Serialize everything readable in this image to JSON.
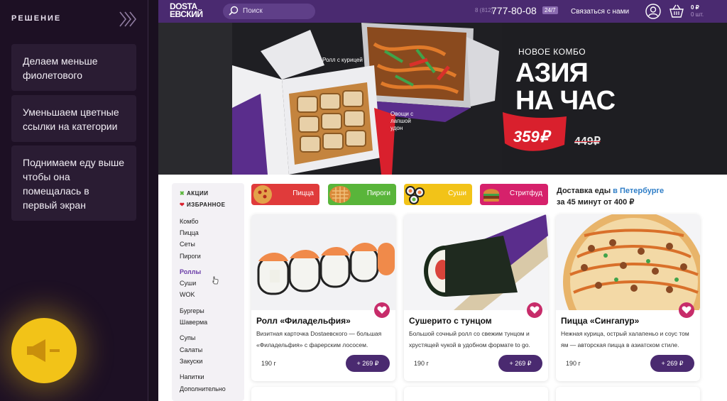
{
  "left_panel": {
    "title": "РЕШЕНИЕ",
    "cards": [
      "Делаем меньше фиолетового",
      "Уменьшаем цветные ссылки на категории",
      "Поднимаем еду выше чтобы она помещалась в первый экран"
    ]
  },
  "header": {
    "logo_line1": "DOSTA",
    "logo_line2": "ЕВСКИЙ",
    "search_placeholder": "Поиск",
    "phone_code": "8 (812)",
    "phone_number": "777-80-08",
    "hours_badge": "24/7",
    "contact_link": "Связаться с нами",
    "cart_sum": "0 ₽",
    "cart_count": "0 шт."
  },
  "banner": {
    "label_roll": "Ролл с курицей",
    "label_veg": "Овощи с лапшой удон",
    "subtitle": "НОВОЕ КОМБО",
    "headline_1": "АЗИЯ",
    "headline_2": "НА ЧАС",
    "price_new": "359₽",
    "price_old": "449₽"
  },
  "sidebar": {
    "promo": [
      {
        "label": "АКЦИИ",
        "icon": "percent-icon"
      },
      {
        "label": "ИЗБРАННОЕ",
        "icon": "heart-icon"
      }
    ],
    "groups": [
      [
        "Комбо",
        "Пицца",
        "Сеты",
        "Пироги"
      ],
      [
        "Роллы",
        "Суши",
        "WOK"
      ],
      [
        "Бургеры",
        "Шаверма"
      ],
      [
        "Супы",
        "Салаты",
        "Закуски"
      ],
      [
        "Напитки",
        "Дополнительно"
      ]
    ],
    "active": "Роллы"
  },
  "categories": [
    {
      "label": "Пицца",
      "color": "#e03b3b"
    },
    {
      "label": "Пироги",
      "color": "#59b53a"
    },
    {
      "label": "Суши",
      "color": "#f2c318"
    },
    {
      "label": "Стритфуд",
      "color": "#d6216b"
    }
  ],
  "delivery": {
    "prefix": "Доставка еды",
    "city": "в Петербурге",
    "line2": "за 45 минут от 400 ₽"
  },
  "products": [
    {
      "name": "Ролл «Филадельфия»",
      "desc": "Визитная карточка Dostaевского — большая «Филадельфия» с фарерским лососем.",
      "weight": "190 г",
      "price": "+ 269 ₽"
    },
    {
      "name": "Сушерито с тунцом",
      "desc": "Большой сочный ролл со свежим тунцом и хрустящей чукой в удобном формате to go.",
      "weight": "190 г",
      "price": "+ 269 ₽"
    },
    {
      "name": "Пицца «Сингапур»",
      "desc": "Нежная курица, острый халапеньо и соус том ям — авторская пицца в азиатском стиле.",
      "weight": "190 г",
      "price": "+ 269 ₽"
    }
  ],
  "colors": {
    "brand_purple": "#4a2a70",
    "accent_red": "#d9202d",
    "heart_pink": "#c72c6a",
    "highlight_yellow": "#f2c318"
  }
}
